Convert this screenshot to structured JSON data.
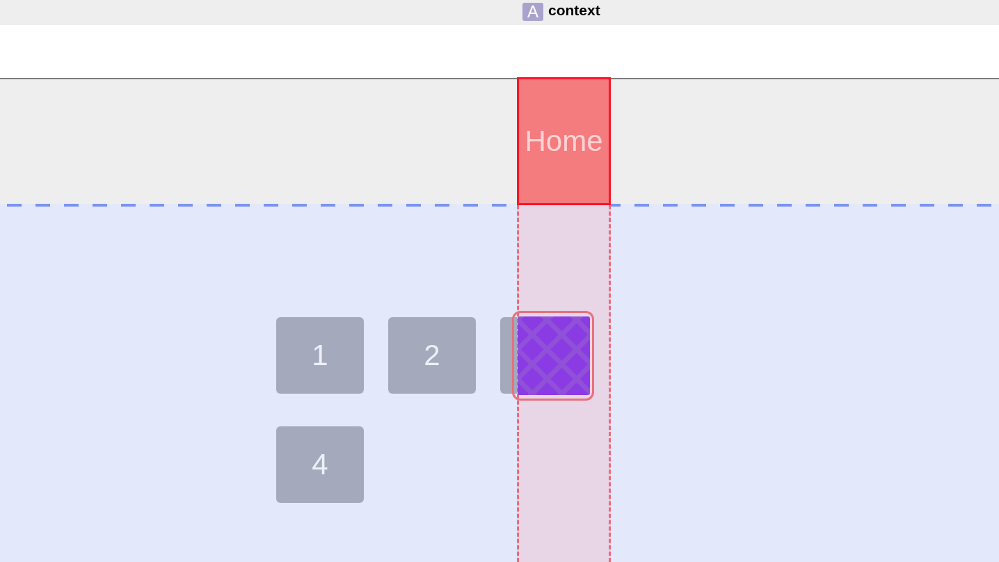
{
  "title_bar": {
    "badge": "A",
    "title": "context"
  },
  "header": {
    "target_label": "Home"
  },
  "tiles": [
    {
      "kind": "numbered",
      "label": "1"
    },
    {
      "kind": "numbered",
      "label": "2"
    },
    {
      "kind": "covered"
    },
    {
      "kind": "numbered",
      "label": "4"
    }
  ],
  "dragged_tile": {
    "selected": true
  }
}
